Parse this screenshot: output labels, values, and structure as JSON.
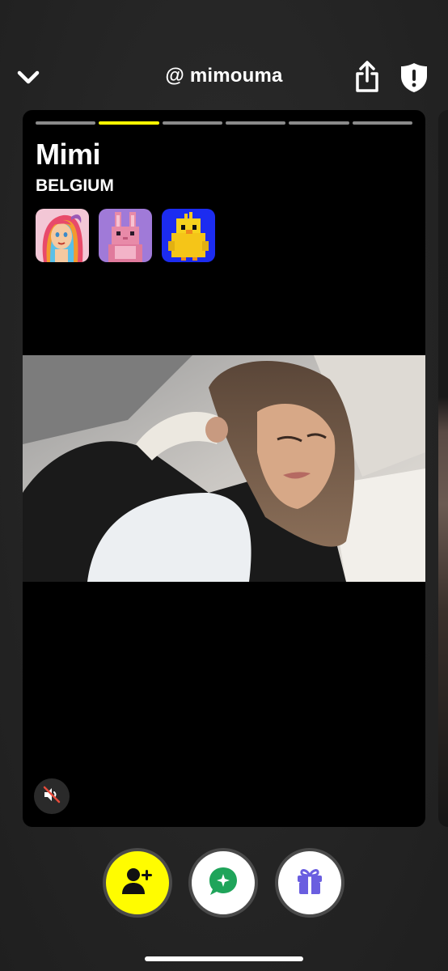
{
  "header": {
    "username": "@ mimouma"
  },
  "profile": {
    "name": "Mimi",
    "country": "BELGIUM",
    "story_segments": 6,
    "active_segment": 1,
    "badges": [
      {
        "icon": "rainbow-girl-avatar-icon"
      },
      {
        "icon": "pixel-bunny-icon"
      },
      {
        "icon": "pixel-chick-icon"
      }
    ]
  },
  "colors": {
    "accent": "#fffc00",
    "card": "#000000",
    "background": "#262626",
    "chat_icon": "#1fa45a",
    "gift_icon": "#6a5ee0"
  }
}
